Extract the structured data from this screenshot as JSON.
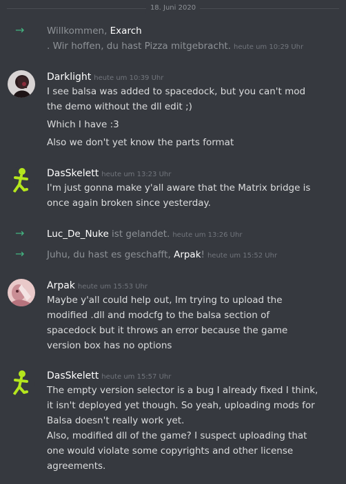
{
  "date_divider": "18. Juni 2020",
  "welcome": {
    "prefix": "Willkommen, ",
    "name": "Exarch",
    "suffix": ". Wir hoffen, du hast Pizza mitgebracht.",
    "time": "heute um 10:29 Uhr"
  },
  "msg_darklight": {
    "author": "Darklight",
    "time": "heute um 10:39 Uhr",
    "lines": [
      "I see balsa was added to spacedock, but you can't mod",
      "the demo without the dll edit ;)",
      "Which I have :3",
      "Also we don't yet know the parts format"
    ]
  },
  "msg_skelett1": {
    "author": "DasSkelett",
    "time": "heute um 13:23 Uhr",
    "lines": [
      "I'm just gonna make y'all aware that the Matrix bridge is",
      "once again broken since yesterday."
    ]
  },
  "join_luc": {
    "name": "Luc_De_Nuke",
    "text": " ist gelandet.",
    "time": "heute um 13:26 Uhr"
  },
  "join_arpak": {
    "prefix": "Juhu, du hast es geschafft, ",
    "name": "Arpak",
    "suffix": "!",
    "time": "heute um 15:52 Uhr"
  },
  "msg_arpak": {
    "author": "Arpak",
    "time": "heute um 15:53 Uhr",
    "lines": [
      "Maybe y'all could help out, Im trying to upload the",
      "modified .dll and modcfg to the balsa section of",
      "spacedock but it throws an error because the game",
      "version box has no options"
    ]
  },
  "msg_skelett2": {
    "author": "DasSkelett",
    "time": "heute um 15:57 Uhr",
    "lines": [
      "The empty version selector is a bug I already fixed I think,",
      "it isn't deployed yet though. So yeah, uploading mods for",
      "Balsa doesn't really work yet.",
      "Also, modified dll of the game? I suspect uploading that",
      "one would violate some copyrights and other license",
      "agreements."
    ]
  },
  "colors": {
    "background": "#36393f",
    "join_arrow": "#43b581",
    "skeleton_avatar": "#b5e61d"
  }
}
